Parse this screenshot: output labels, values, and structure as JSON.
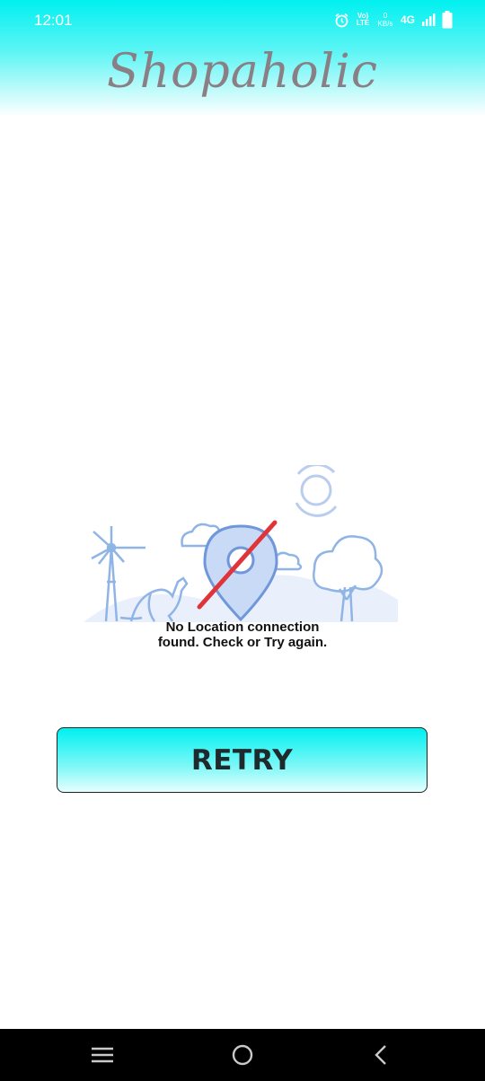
{
  "status_bar": {
    "time": "12:01",
    "volte_label_top": "Vo)",
    "volte_label_bottom": "LTE",
    "speed_value": "0",
    "speed_unit": "KB/s",
    "network": "4G"
  },
  "header": {
    "title": "Shopaholic"
  },
  "error": {
    "message": "No Location connection found. Check or Try again."
  },
  "actions": {
    "retry_label": "RETRY"
  },
  "nav_bar": {
    "icons": [
      "menu-icon",
      "home-icon",
      "back-icon"
    ]
  },
  "colors": {
    "accent": "#00f0f0",
    "title": "#8a7f85",
    "illustration": "#8fb4e6",
    "slash": "#e0343a"
  }
}
